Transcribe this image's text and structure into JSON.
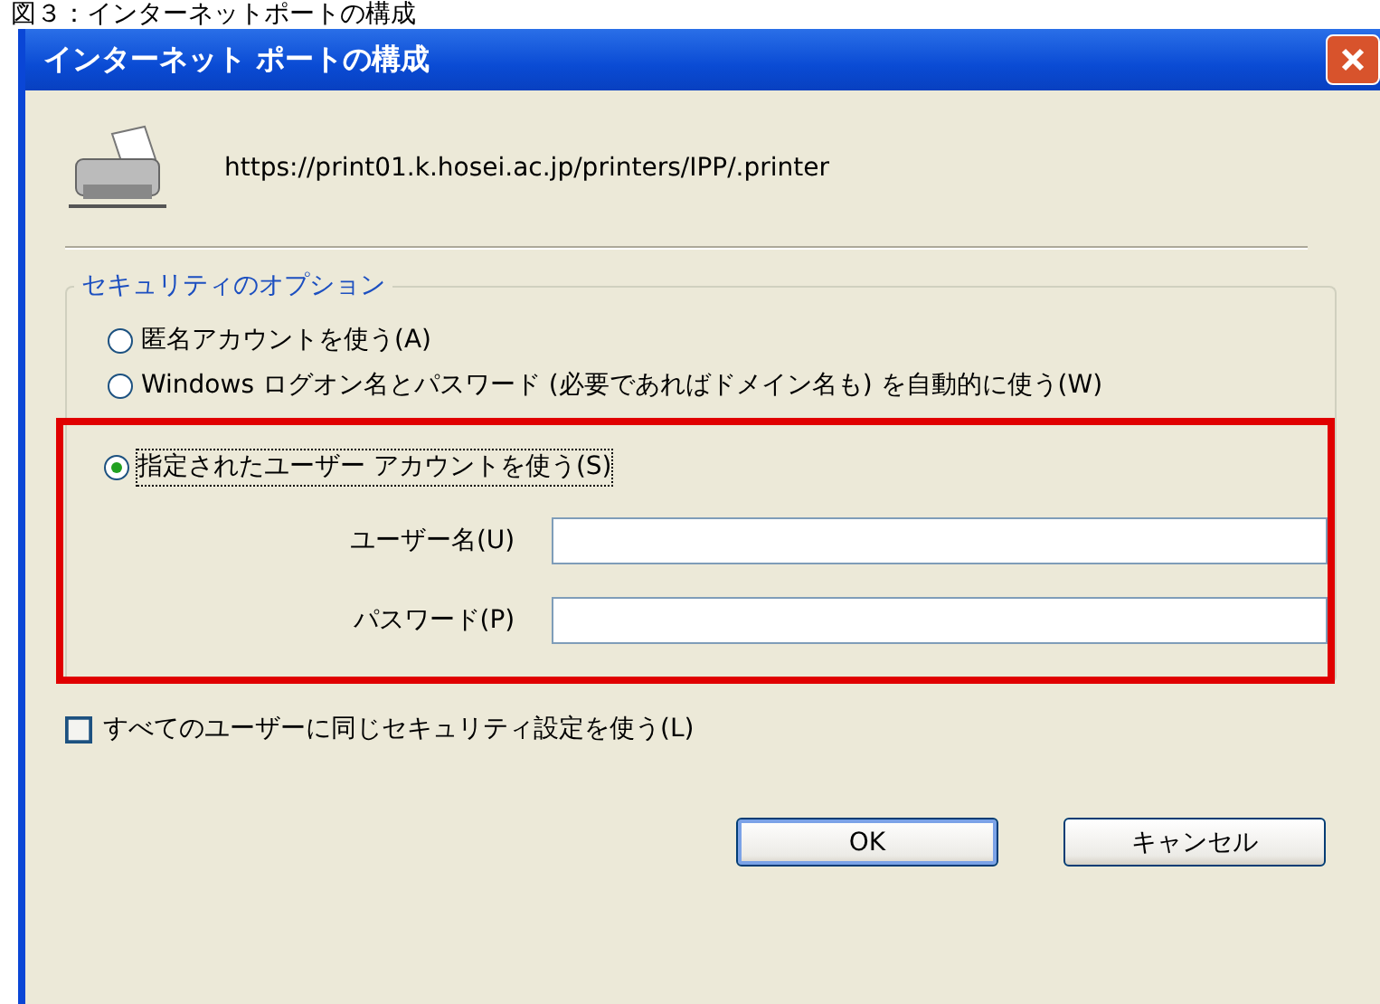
{
  "caption": "図３：インターネットポートの構成",
  "window": {
    "title": "インターネット ポートの構成"
  },
  "url": "https://print01.k.hosei.ac.jp/printers/IPP/.printer",
  "security": {
    "label": "セキュリティのオプション",
    "options": [
      {
        "label": "匿名アカウントを使う(A)",
        "selected": false
      },
      {
        "label": "Windows ログオン名とパスワード (必要であればドメイン名も) を自動的に使う(W)",
        "selected": false
      },
      {
        "label": "指定されたユーザー アカウントを使う(S)",
        "selected": true
      }
    ],
    "fields": [
      {
        "label": "ユーザー名(U)"
      },
      {
        "label": "パスワード(P)"
      }
    ]
  },
  "checkbox": {
    "label": "すべてのユーザーに同じセキュリティ設定を使う(L)",
    "checked": false
  },
  "buttons": [
    {
      "label": "OK",
      "default": true
    },
    {
      "label": "キャンセル",
      "default": false
    }
  ]
}
